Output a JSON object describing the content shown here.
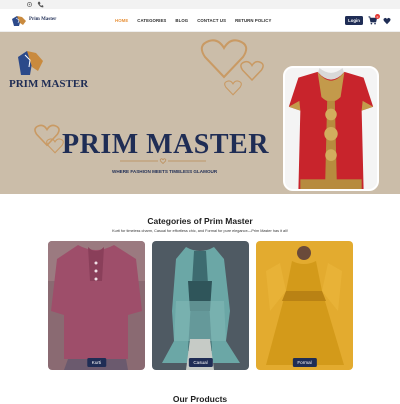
{
  "colors": {
    "navy": "#1f2d55",
    "accent": "#e8923a",
    "hero_bg": "#cbbda9",
    "badge": "#e53935"
  },
  "topbar": {
    "icons": [
      "settings-icon",
      "phone-icon"
    ]
  },
  "navbar": {
    "brand": "Prim Master",
    "menu": [
      "HOME",
      "CATEGORIES",
      "BLOG",
      "CONTACT US",
      "RETURN POLICY"
    ],
    "active": "HOME",
    "login_label": "Login",
    "cart_count": "0",
    "icons": [
      "cart-icon",
      "heart-icon"
    ]
  },
  "hero": {
    "brand_small": "PRIM MASTER",
    "title": "PRIM MASTER",
    "tagline": "WHERE FASHION MEETS TIMELESS GLAMOUR"
  },
  "categories": {
    "title": "Categories of Prim Master",
    "subtitle": "Kurti for timeless charm, Casual for effortless chic, and Formal for pure elegance—Prim Master has it all!",
    "items": [
      {
        "label": "Kurti"
      },
      {
        "label": "Casual"
      },
      {
        "label": "Formal"
      }
    ]
  },
  "products": {
    "title": "Our Products"
  }
}
